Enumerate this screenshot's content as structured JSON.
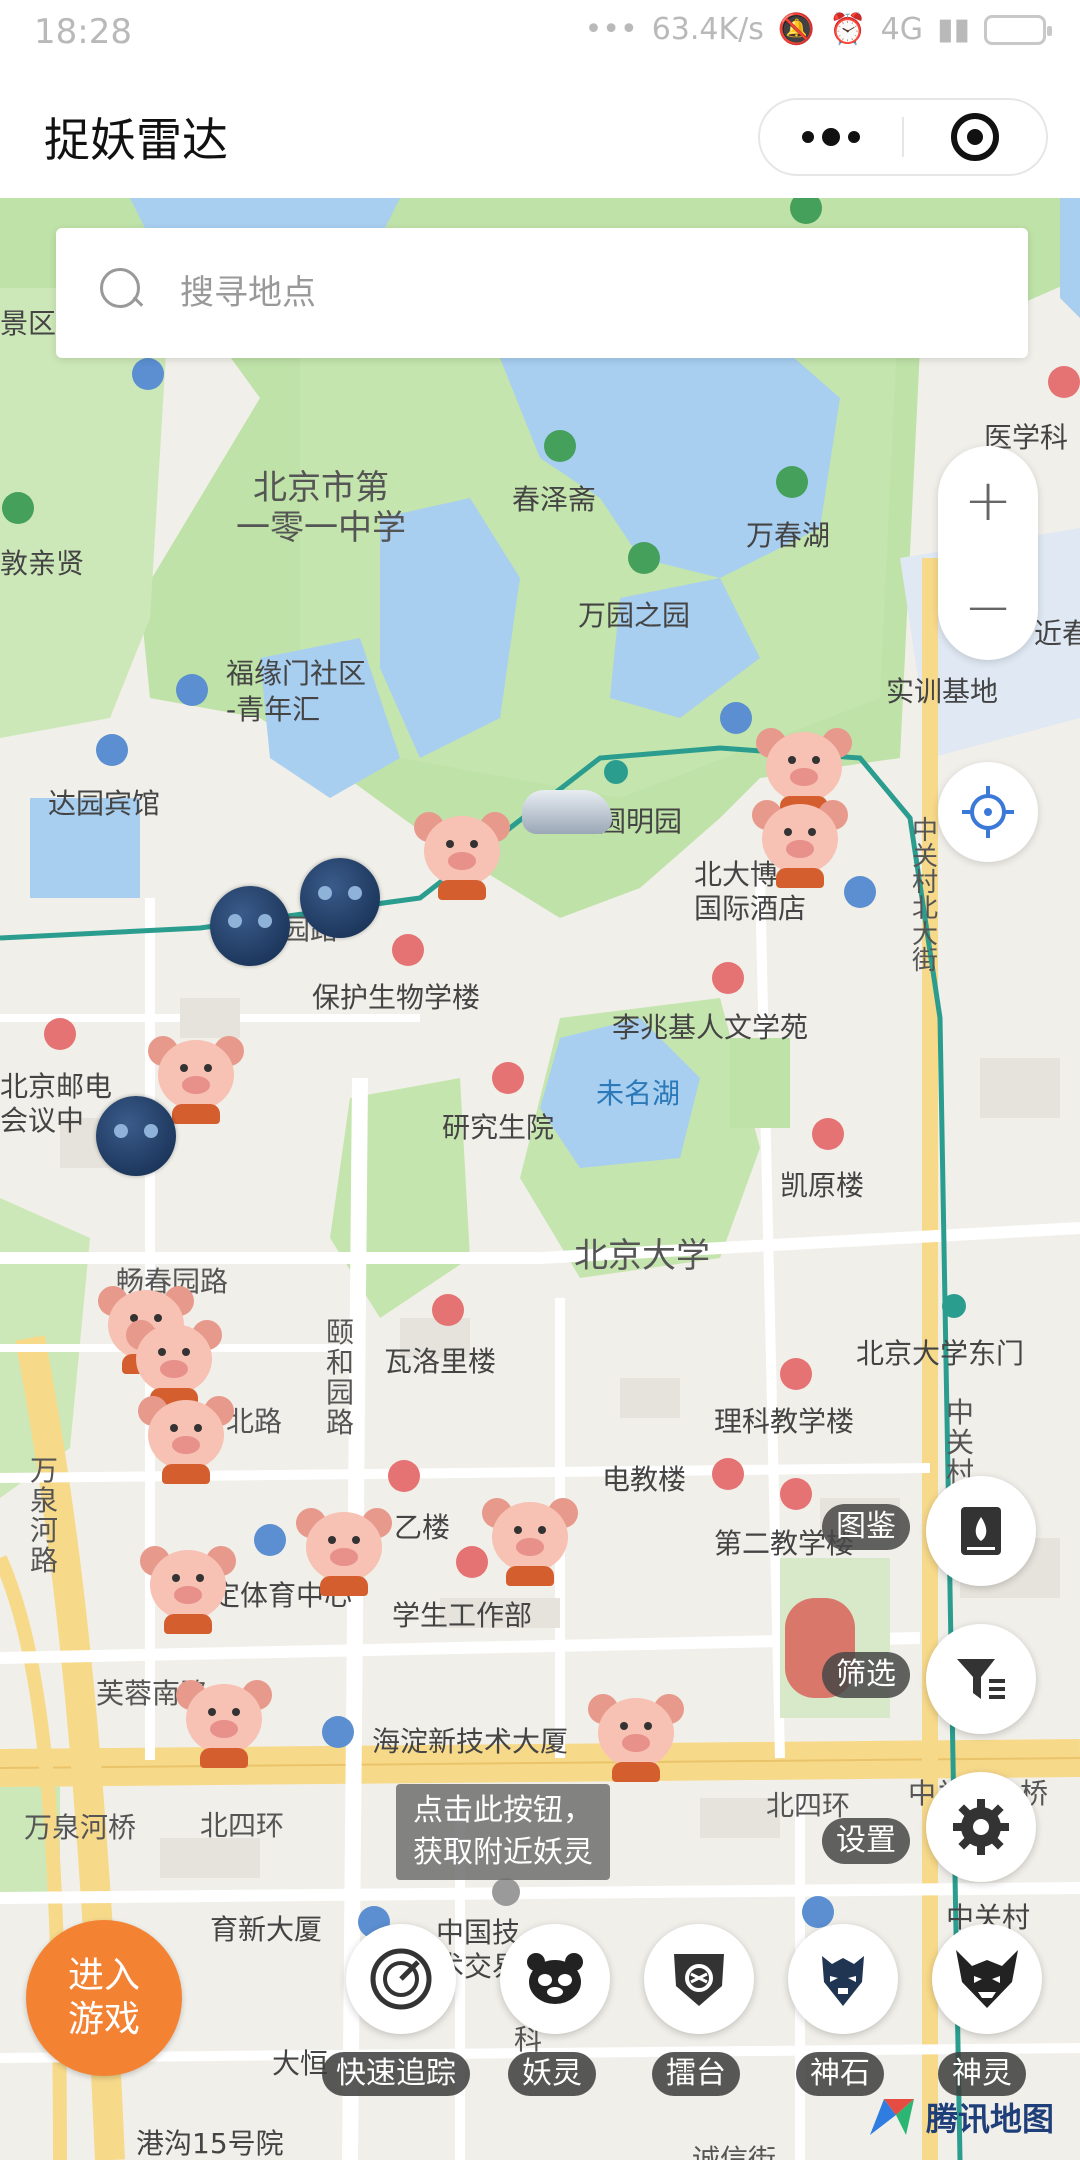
{
  "status": {
    "time": "18:28",
    "network": "63.4K/s",
    "signal": "4G"
  },
  "app": {
    "title": "捉妖雷达"
  },
  "search": {
    "placeholder": "搜寻地点"
  },
  "map_labels": {
    "school101": "北京市第\n一零一中学",
    "chunze": "春泽斋",
    "wanchunhu": "万春湖",
    "wanyuan": "万园之园",
    "yixue": "医学科",
    "jinchun": "近春",
    "shixun": "实训基地",
    "fuyuanmen": "福缘门社区\n-青年汇",
    "dayuan": "达园宾馆",
    "yuanmingyuan": "圆明园",
    "pkuhotel": "北大博雅\n国际酒店",
    "zhongguancun_bei": "中关村北大街",
    "baohu": "保护生物学楼",
    "lizhaoji": "李兆基人文学苑",
    "weiminghu": "未名湖",
    "yanjiusheng": "研究生院",
    "kaiyuan": "凯原楼",
    "youdian": "北京邮电\n会议中",
    "pku": "北京大学",
    "changchun": "畅春园路",
    "yiheyuan": "颐\n和\n园\n路",
    "waluoli": "瓦洛里楼",
    "pkueast": "北京大学东门",
    "like": "理科教学楼",
    "dianjiao": "电教楼",
    "wanquanhe": "万\n泉\n河\n路",
    "yilou": "乙楼",
    "dierjiao": "第二教学楼",
    "tiyu": "定体育中心",
    "xuesheng": "学生工作部",
    "furong": "芙蓉南路",
    "haidian": "海淀新技术大厦",
    "wanquanqiao": "万泉河桥",
    "beisihuan1": "北四环",
    "beisihuan2": "北四环",
    "zhongguancun_qiao": "中关村一桥",
    "zhongguancun": "中关村",
    "yuxin": "育新大厦",
    "zhongguo": "中国技\n术交易",
    "gangou": "港沟15号院",
    "dahen": "大恒",
    "yinluo": "北京邮电",
    "beilu": "北路",
    "zhongguancun_dajie": "中\n关\n村",
    "qinxian": "敦亲贤",
    "jingqu": "景区",
    "yiyuan": "园路",
    "cheng": "科",
    "jingxin": "诚信街"
  },
  "hint": {
    "text": "点击此按钮，\n获取附近妖灵"
  },
  "side_actions": [
    {
      "label": "图鉴",
      "icon": "book-icon"
    },
    {
      "label": "筛选",
      "icon": "filter-icon"
    },
    {
      "label": "设置",
      "icon": "gear-icon"
    }
  ],
  "enter_game": {
    "label": "进入\n游戏"
  },
  "bottom_nav": [
    {
      "label": "快速追踪",
      "icon": "radar-icon"
    },
    {
      "label": "妖灵",
      "icon": "panda-icon"
    },
    {
      "label": "擂台",
      "icon": "shield-icon"
    },
    {
      "label": "神石",
      "icon": "demon-mask-icon"
    },
    {
      "label": "神灵",
      "icon": "horned-mask-icon"
    }
  ],
  "map_provider": "腾讯地图",
  "colors": {
    "accent": "#f38233",
    "water": "#a8cef0",
    "park": "#bfe2a8",
    "road": "#ffffff",
    "major_road": "#f7d98a",
    "rail": "#2a9d8f"
  }
}
